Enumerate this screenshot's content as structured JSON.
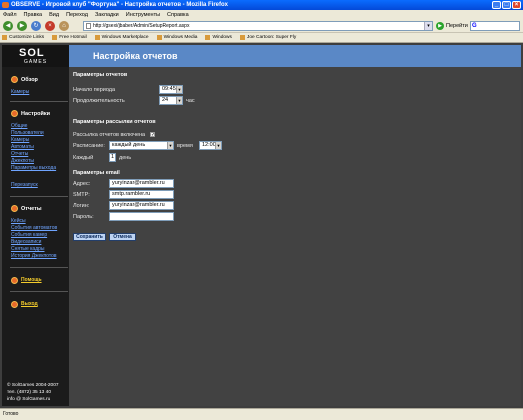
{
  "browser": {
    "title": "OBSERVE - Игровой клуб \"Фортуна\" - Настройка отчетов - Mozilla Firefox",
    "menu": [
      "Файл",
      "Правка",
      "Вид",
      "Переход",
      "Закладки",
      "Инструменты",
      "Справка"
    ],
    "url": "http://gsexi/jbaber/Admin/SetupReport.aspx",
    "go_label": "Перейти",
    "search_label": "G",
    "bookmarks": [
      "Customize Links",
      "Free Hotmail",
      "Windows Marketplace",
      "Windows Media",
      "Windows",
      "Joe Cartoon: Super Fly"
    ],
    "status": "Готово"
  },
  "logo": {
    "top": "SOL",
    "bottom": "GAMES"
  },
  "page_title": "Настройка отчетов",
  "sidebar": {
    "overview": {
      "title": "Обзор",
      "links": [
        "Камеры"
      ]
    },
    "settings": {
      "title": "Настройки",
      "links": [
        "Общие",
        "Пользователи",
        "Камеры",
        "Автоматы",
        "Отчеты",
        "Джекпоты",
        "Параметры выхода"
      ],
      "extra_link": "Перезапуск"
    },
    "reports": {
      "title": "Отчеты",
      "links": [
        "Кейсы",
        "События автоматов",
        "События камер",
        "Видеозаписи",
        "Снятые кадры",
        "История Джекпотов"
      ]
    },
    "help": "Помощь",
    "logout": "Выход",
    "footer": [
      "© SolGames 2004-2007",
      "тел. (4872) 35 13 40",
      "info @ SolGames.ru"
    ]
  },
  "report_params": {
    "heading": "Параметры отчетов",
    "period_start_label": "Начало периода",
    "period_start_value": "09:45",
    "duration_label": "Продолжительность",
    "duration_value": "24",
    "duration_unit": "час"
  },
  "mailing_params": {
    "heading": "Параметры рассылки отчетов",
    "enabled_label": "Рассылка отчетов включена",
    "enabled_check": "✓",
    "schedule_label": "Расписание:",
    "schedule_value": "каждый день",
    "time_label": "время",
    "time_value": "12:00",
    "every_label": "Каждый",
    "every_value": "1",
    "every_unit": "день"
  },
  "email_params": {
    "heading": "Параметры email",
    "address_label": "Адрес:",
    "address_value": "yuryinzar@rambler.ru",
    "smtp_label": "SMTP:",
    "smtp_value": "smtp.rambler.ru",
    "login_label": "Логин:",
    "login_value": "yuryinzar@rambler.ru",
    "password_label": "Пароль:",
    "password_value": ""
  },
  "buttons": {
    "save": "Сохранить",
    "cancel": "Отмена"
  }
}
